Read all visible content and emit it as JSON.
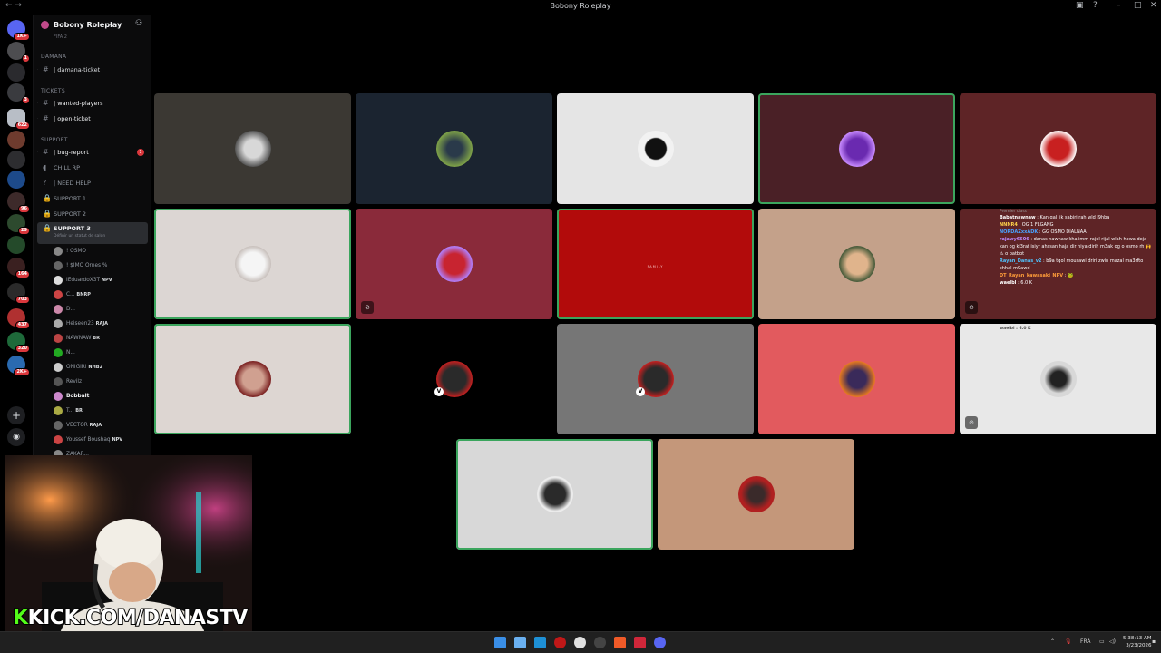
{
  "window": {
    "title": "Bobony Roleplay"
  },
  "server": {
    "name": "Bobony Roleplay",
    "sidebar_top_label": "FIFA 2"
  },
  "rail": {
    "badges": [
      "1K+",
      "1",
      "3",
      "622",
      "96",
      "29",
      "164",
      "703",
      "437",
      "320",
      "2K+"
    ]
  },
  "channels": {
    "cat_damana": "DAMANA",
    "damana_ticket": "| damana-ticket",
    "cat_tickets": "TICKETS",
    "wanted_players": "| wanted-players",
    "open_ticket": "| open-ticket",
    "cat_support": "SUPPORT",
    "bug_report": "| bug-report",
    "bug_report_badge": "1",
    "chill_rp": "CHILL RP",
    "need_help": "| NEED HELP",
    "support1": "SUPPORT 1",
    "support2": "SUPPORT 2",
    "support3": "SUPPORT 3",
    "support3_status": "Définir un statut de salon"
  },
  "members": [
    {
      "name": "! OSMO",
      "tag": ""
    },
    {
      "name": "! $IMO Ornes %",
      "tag": ""
    },
    {
      "name": "IEduardoX3T",
      "tag": "NPV"
    },
    {
      "name": "C...",
      "tag": "BNRP"
    },
    {
      "name": "D...",
      "tag": ""
    },
    {
      "name": "Heiseen23",
      "tag": "RAJA"
    },
    {
      "name": "NAWNAW",
      "tag": "BR"
    },
    {
      "name": "N...",
      "tag": ""
    },
    {
      "name": "ONIGIRI",
      "tag": "NHB2"
    },
    {
      "name": "Revilz",
      "tag": ""
    },
    {
      "name": "Bobbalt",
      "tag": ""
    },
    {
      "name": "T...",
      "tag": "BR"
    },
    {
      "name": "VECTOR",
      "tag": "RAJA"
    },
    {
      "name": "Youssef Boushaq",
      "tag": "NPV"
    },
    {
      "name": "ZAKAR...",
      "tag": ""
    }
  ],
  "tiles": {
    "tile8_text": "FAMILY"
  },
  "chat": {
    "header": "Premier class",
    "lines": [
      {
        "user": "Babatnawnaw",
        "msg": " : Kan gal lik sabiri rah wld l9hba",
        "color": "#ffffff"
      },
      {
        "user": "NNNR4",
        "msg": " : OG 1 FLGANG",
        "color": "#ffd24a"
      },
      {
        "user": "NORDAZxxADK",
        "msg": " : GG OSMO DIALNAA",
        "color": "#4aa3ff"
      },
      {
        "user": "rajawy6606",
        "msg": " : danas nawnaw khaiimm rajel rijal wlah howa deja kan og kl3raf isiyr ahssan haja dir hiya dirih m3ak og o osmo rh 🙌 ⚠ o batbot",
        "color": "#c08aff"
      },
      {
        "user": "Rayan_Danas_v2",
        "msg": " : b9a tqol mousawi driri zwin mazal ma3rfto chhal m9awd",
        "color": "#4fc3ff"
      },
      {
        "user": "DT_Rayan_kawasaki_NPV",
        "msg": " : 🐸",
        "color": "#ff9d3a"
      },
      {
        "user": "waelbl",
        "msg": " : 6.0 K",
        "color": "#ffffff"
      }
    ],
    "top_line": "waelbl : 6.0 K"
  },
  "overlay": {
    "kick_prefix": "K",
    "kick_rest": "KICK.COM/DANASTV"
  },
  "taskbar": {
    "lang": "FRA",
    "time": "5:38:13 AM",
    "date": "3/23/2026"
  },
  "colors": {
    "speaking": "#3ba55d",
    "kick_green": "#53fc18",
    "badge_red": "#da373c"
  }
}
